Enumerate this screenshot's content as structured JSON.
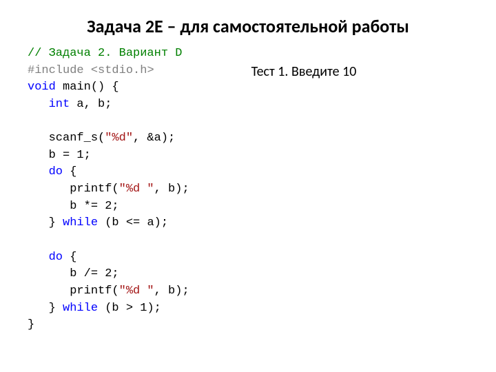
{
  "title": "Задача 2E – для самостоятельной работы",
  "code": {
    "comment": "// Задача 2. Вариант D",
    "preproc": "#include",
    "include_target": "<stdio.h>",
    "kw_void": "void",
    "main_sig": " main() {",
    "kw_int": "int",
    "decl_rest": " a, b;",
    "scanf": "   scanf_s(",
    "str_d": "\"%d\"",
    "scanf_tail": ", &a);",
    "b_eq_1": "   b = 1;",
    "kw_do1": "do",
    "brace1": " {",
    "printf1a": "      printf(",
    "str_d_sp": "\"%d \"",
    "printf1b": ", b);",
    "b_mul2": "      b *= 2;",
    "close1": "   } ",
    "kw_while1": "while",
    "cond1": " (b <= a);",
    "kw_do2": "do",
    "brace2": " {",
    "b_div2": "      b /= 2;",
    "printf2a": "      printf(",
    "printf2b": ", b);",
    "close2": "   } ",
    "kw_while2": "while",
    "cond2": " (b > 1);",
    "end_brace": "}"
  },
  "test": {
    "line1": "Тест 1. Введите 10"
  }
}
